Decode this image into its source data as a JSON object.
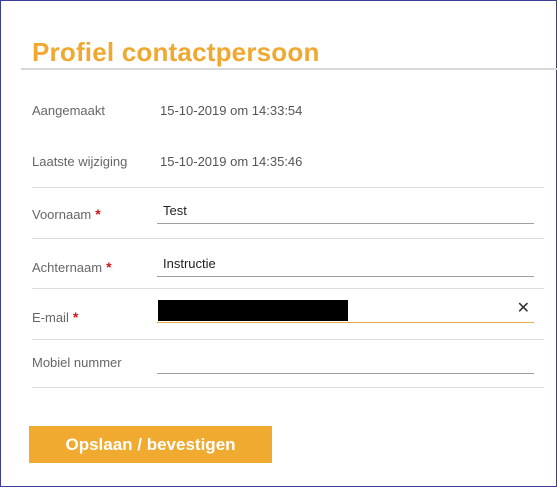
{
  "page": {
    "title": "Profiel contactpersoon"
  },
  "fields": {
    "created": {
      "label": "Aangemaakt",
      "value": "15-10-2019 om 14:33:54"
    },
    "modified": {
      "label": "Laatste wijziging",
      "value": "15-10-2019 om 14:35:46"
    },
    "first_name": {
      "label": "Voornaam",
      "required_marker": "*",
      "value": "Test"
    },
    "last_name": {
      "label": "Achternaam",
      "required_marker": "*",
      "value": "Instructie"
    },
    "email": {
      "label": "E-mail",
      "required_marker": "*",
      "value": "",
      "value_redacted": true,
      "clear_icon": "close-icon"
    },
    "mobile": {
      "label": "Mobiel nummer",
      "value": ""
    }
  },
  "actions": {
    "save_label": "Opslaan / bevestigen"
  },
  "colors": {
    "accent": "#f0aa2f",
    "required": "#d0161b",
    "border": "#3b3f9a"
  }
}
